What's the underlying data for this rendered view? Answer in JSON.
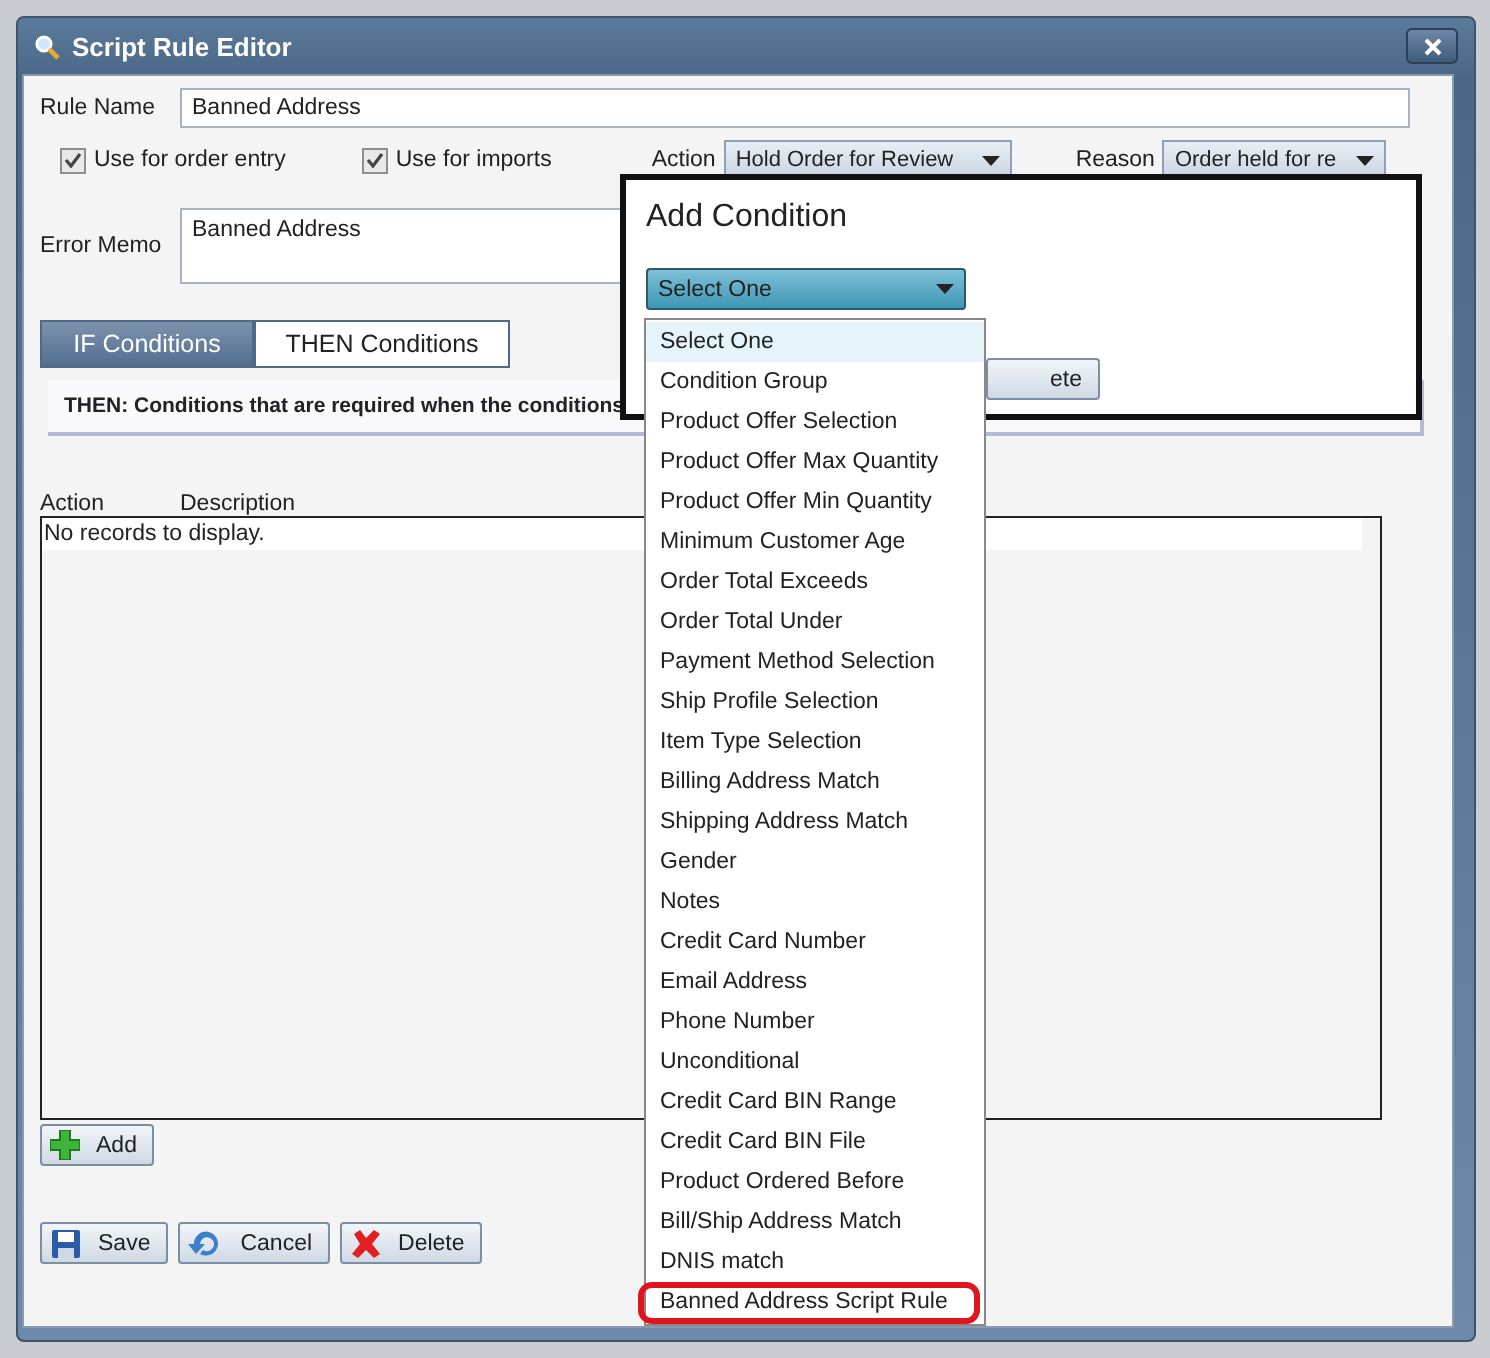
{
  "window": {
    "title": "Script Rule Editor"
  },
  "rule_name": {
    "label": "Rule Name",
    "value": "Banned Address"
  },
  "options": [
    {
      "label": "Use for order entry",
      "checked": true
    },
    {
      "label": "Use for imports",
      "checked": true
    }
  ],
  "action": {
    "label": "Action",
    "value": "Hold Order for Review"
  },
  "reason": {
    "label": "Reason",
    "value": "Order held for re"
  },
  "error_memo": {
    "label": "Error Memo",
    "value": "Banned Address"
  },
  "tabs": [
    {
      "label": "IF Conditions",
      "selected": false
    },
    {
      "label": "THEN Conditions",
      "selected": true
    }
  ],
  "info": "THEN: Conditions that are required when the conditions",
  "table": {
    "columns": [
      "Action",
      "Description"
    ],
    "empty_text": "No records to display."
  },
  "add_button": "Add",
  "buttons": [
    {
      "kind": "save",
      "label": "Save"
    },
    {
      "kind": "cancel",
      "label": "Cancel"
    },
    {
      "kind": "delete",
      "label": "Delete"
    }
  ],
  "popup": {
    "title": "Add Condition",
    "select_value": "Select One",
    "hidden_button": "ete",
    "options": [
      {
        "label": "Select One",
        "selected": true,
        "circled": false
      },
      {
        "label": "Condition Group",
        "selected": false,
        "circled": false
      },
      {
        "label": "Product Offer Selection",
        "selected": false,
        "circled": false
      },
      {
        "label": "Product Offer Max Quantity",
        "selected": false,
        "circled": false
      },
      {
        "label": "Product Offer Min Quantity",
        "selected": false,
        "circled": false
      },
      {
        "label": "Minimum Customer Age",
        "selected": false,
        "circled": false
      },
      {
        "label": "Order Total Exceeds",
        "selected": false,
        "circled": false
      },
      {
        "label": "Order Total Under",
        "selected": false,
        "circled": false
      },
      {
        "label": "Payment Method Selection",
        "selected": false,
        "circled": false
      },
      {
        "label": "Ship Profile Selection",
        "selected": false,
        "circled": false
      },
      {
        "label": "Item Type Selection",
        "selected": false,
        "circled": false
      },
      {
        "label": "Billing Address Match",
        "selected": false,
        "circled": false
      },
      {
        "label": "Shipping Address Match",
        "selected": false,
        "circled": false
      },
      {
        "label": "Gender",
        "selected": false,
        "circled": false
      },
      {
        "label": "Notes",
        "selected": false,
        "circled": false
      },
      {
        "label": "Credit Card Number",
        "selected": false,
        "circled": false
      },
      {
        "label": "Email Address",
        "selected": false,
        "circled": false
      },
      {
        "label": "Phone Number",
        "selected": false,
        "circled": false
      },
      {
        "label": "Unconditional",
        "selected": false,
        "circled": false
      },
      {
        "label": "Credit Card BIN Range",
        "selected": false,
        "circled": false
      },
      {
        "label": "Credit Card BIN File",
        "selected": false,
        "circled": false
      },
      {
        "label": "Product Ordered Before",
        "selected": false,
        "circled": false
      },
      {
        "label": "Bill/Ship Address Match",
        "selected": false,
        "circled": false
      },
      {
        "label": "DNIS match",
        "selected": false,
        "circled": false
      },
      {
        "label": "Banned Address Script Rule",
        "selected": false,
        "circled": true
      }
    ]
  }
}
